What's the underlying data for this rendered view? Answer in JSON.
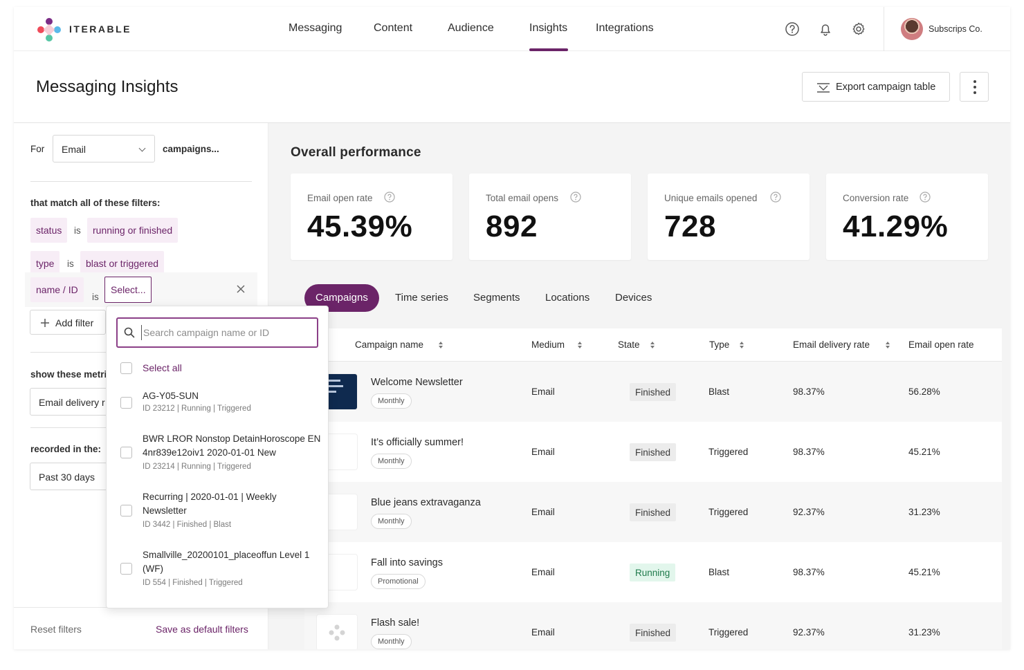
{
  "header": {
    "logo_text": "ITERABLE",
    "nav": [
      "Messaging",
      "Content",
      "Audience",
      "Insights",
      "Integrations"
    ],
    "active_nav": "Insights",
    "company": "Subscrips Co."
  },
  "page": {
    "title": "Messaging Insights",
    "export_label": "Export campaign table"
  },
  "filters": {
    "for_label": "For",
    "medium_value": "Email",
    "campaigns_suffix": "campaigns...",
    "match_label": "that match all of these filters:",
    "rows": [
      {
        "field": "status",
        "op": "is",
        "value": "running or finished"
      },
      {
        "field": "type",
        "op": "is",
        "value": "blast or triggered"
      },
      {
        "field": "name / ID",
        "op": "is",
        "value": "Select..."
      }
    ],
    "add_filter_label": "Add filter",
    "metrics_label": "show these metri",
    "metrics_value": "Email delivery r",
    "recorded_label": "recorded in the:",
    "recorded_value": "Past 30 days",
    "reset_label": "Reset filters",
    "save_label": "Save as default filters"
  },
  "dropdown": {
    "search_placeholder": "Search campaign name or ID",
    "select_all": "Select all",
    "items": [
      {
        "name": "AG-Y05-SUN",
        "meta": "ID 23212  |  Running  |  Triggered"
      },
      {
        "name": "BWR LROR Nonstop DetainHoroscope EN 4nr839e12oiv1 2020-01-01 New",
        "meta": "ID 23214  |  Running  |  Triggered"
      },
      {
        "name": "Recurring | 2020-01-01 | Weekly Newsletter",
        "meta": "ID 3442  |  Finished  |  Blast"
      },
      {
        "name": "Smallville_20200101_placeoffun Level 1 (WF)",
        "meta": "ID 554  |  Finished  |  Triggered"
      }
    ]
  },
  "overview": {
    "title": "Overall performance",
    "cards": [
      {
        "label": "Email open rate",
        "value": "45.39%"
      },
      {
        "label": "Total email opens",
        "value": "892"
      },
      {
        "label": "Unique emails opened",
        "value": "728"
      },
      {
        "label": "Conversion rate",
        "value": "41.29%"
      }
    ]
  },
  "tabs": [
    "Campaigns",
    "Time series",
    "Segments",
    "Locations",
    "Devices"
  ],
  "active_tab": "Campaigns",
  "table": {
    "columns": [
      "Campaign name",
      "Medium",
      "State",
      "Type",
      "Email delivery rate",
      "Email open rate"
    ],
    "rows": [
      {
        "name": "Welcome Newsletter",
        "tag": "Monthly",
        "medium": "Email",
        "state": "Finished",
        "type": "Blast",
        "delivery": "98.37%",
        "open": "56.28%"
      },
      {
        "name": "It’s officially summer!",
        "tag": "Monthly",
        "medium": "Email",
        "state": "Finished",
        "type": "Triggered",
        "delivery": "98.37%",
        "open": "45.21%"
      },
      {
        "name": "Blue jeans extravaganza",
        "tag": "Monthly",
        "medium": "Email",
        "state": "Finished",
        "type": "Triggered",
        "delivery": "92.37%",
        "open": "31.23%"
      },
      {
        "name": "Fall into savings",
        "tag": "Promotional",
        "medium": "Email",
        "state": "Running",
        "type": "Blast",
        "delivery": "98.37%",
        "open": "45.21%"
      },
      {
        "name": "Flash sale!",
        "tag": "Monthly",
        "medium": "Email",
        "state": "Finished",
        "type": "Triggered",
        "delivery": "92.37%",
        "open": "31.23%"
      }
    ]
  },
  "colors": {
    "brand": "#6b2468",
    "chip_bg": "#f7edf6",
    "running_bg": "#e2f6ec",
    "running_text": "#1e7a4b",
    "main_bg": "#f4f4f4"
  }
}
